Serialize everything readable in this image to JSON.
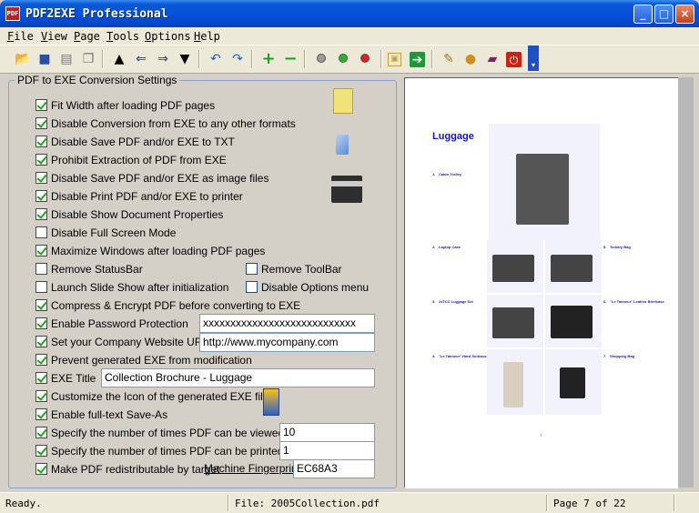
{
  "window": {
    "title": "PDF2EXE Professional",
    "icon_label": "PDF"
  },
  "menu": [
    "File",
    "View",
    "Page",
    "Tools",
    "Options",
    "Help"
  ],
  "toolbar": {
    "buttons": [
      "open-icon",
      "save-icon",
      "print-icon",
      "copy-icon",
      "arrow-up-icon",
      "arrow-left-icon",
      "arrow-right-icon",
      "arrow-down-icon",
      "undo-icon",
      "redo-icon",
      "zoom-in-icon",
      "zoom-out-icon",
      "gray-dot-icon",
      "green-dot-icon",
      "red-dot-icon",
      "fit-icon",
      "export-icon",
      "tools-icon",
      "globe-icon",
      "book-icon",
      "power-icon"
    ]
  },
  "settings": {
    "title": "PDF to EXE Conversion Settings",
    "options": [
      {
        "label": "Fit Width after loading PDF pages",
        "checked": true
      },
      {
        "label": "Disable Conversion from EXE to any other formats",
        "checked": true
      },
      {
        "label": "Disable Save PDF and/or EXE to TXT",
        "checked": true
      },
      {
        "label": "Prohibit Extraction of PDF from EXE",
        "checked": true
      },
      {
        "label": "Disable Save PDF and/or EXE as image files",
        "checked": true
      },
      {
        "label": "Disable Print PDF and/or EXE to printer",
        "checked": true
      },
      {
        "label": "Disable Show Document Properties",
        "checked": true
      },
      {
        "label": "Disable Full Screen Mode",
        "checked": false
      },
      {
        "label": "Maximize Windows after loading PDF pages",
        "checked": true
      },
      {
        "label": "Remove StatusBar",
        "checked": false
      },
      {
        "label": "Remove ToolBar",
        "checked": false
      },
      {
        "label": "Launch Slide Show after initialization",
        "checked": false
      },
      {
        "label": "Disable Options menu",
        "checked": false
      },
      {
        "label": "Compress & Encrypt PDF before converting to EXE",
        "checked": true
      },
      {
        "label": "Enable Password Protection",
        "checked": true
      },
      {
        "label": "Set your Company Website URL",
        "checked": true
      },
      {
        "label": "Prevent generated EXE from modification",
        "checked": true
      },
      {
        "label": "EXE Title",
        "checked": true
      },
      {
        "label": "Customize the Icon of the generated EXE file",
        "checked": true
      },
      {
        "label": "Enable full-text Save-As",
        "checked": true
      },
      {
        "label": "Specify the number of times PDF can be viewed",
        "checked": true
      },
      {
        "label": "Specify the number of times PDF can be printed",
        "checked": true
      },
      {
        "label": "Make PDF redistributable by target",
        "checked": true
      }
    ],
    "password_value": "xxxxxxxxxxxxxxxxxxxxxxxxxxxx",
    "url_value": "http://www.mycompany.com",
    "exe_title_value": "Collection Brochure - Luggage",
    "views_value": "10",
    "prints_value": "1",
    "fingerprint_label": "Machine Fingerprint",
    "fingerprint_value": "EC68A3"
  },
  "preview": {
    "heading": "Luggage",
    "items": [
      {
        "num": "1.",
        "name": "Cabin Trolley"
      },
      {
        "num": "2.",
        "name": "Laptop Case"
      },
      {
        "num": "3.",
        "name": "24TCC Luggage Set"
      },
      {
        "num": "4.",
        "name": "\"Le Tanneur\" Hard Suitcase"
      },
      {
        "num": "5.",
        "name": "Toiletry Bag"
      },
      {
        "num": "6.",
        "name": "\"Le Tanneur\" Leather Briefcase"
      },
      {
        "num": "7.",
        "name": "Shopping Bag"
      }
    ],
    "page_number": "7"
  },
  "status": {
    "left": "Ready.",
    "file": "File: 2005Collection.pdf",
    "page": "Page 7 of 22"
  }
}
